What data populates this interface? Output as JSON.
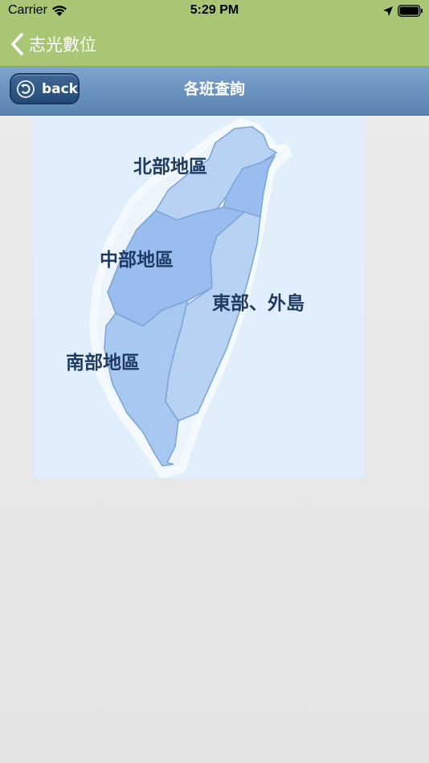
{
  "status_bar": {
    "carrier": "Carrier",
    "time": "5:29 PM",
    "icons": [
      "wifi-icon",
      "location-arrow-icon",
      "battery-icon"
    ]
  },
  "nav": {
    "back_title": "志光數位",
    "back_icon": "chevron-left-icon",
    "tint": "#ffffff",
    "background": "#a8c674"
  },
  "header": {
    "back_label": "back",
    "back_icon": "undo-arrow-icon",
    "title": "各班查詢",
    "background": "#6a92bd"
  },
  "map": {
    "regions": [
      {
        "id": "north",
        "label": "北部地區",
        "color": "#b7d2f3"
      },
      {
        "id": "central",
        "label": "中部地區",
        "color": "#98bdee"
      },
      {
        "id": "east",
        "label": "東部、外島",
        "color": "#b7d2f3"
      },
      {
        "id": "south",
        "label": "南部地區",
        "color": "#a6c8f1"
      }
    ]
  }
}
